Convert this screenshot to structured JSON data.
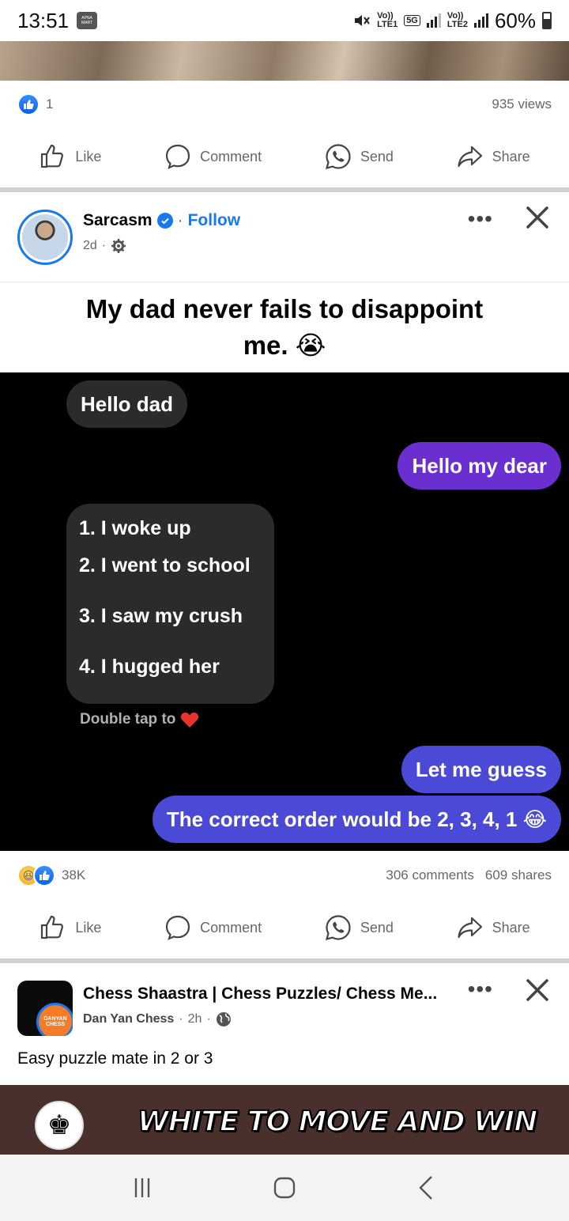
{
  "status_bar": {
    "time": "13:51",
    "carrier_badge": "APNA MART",
    "sim1_label": "Vo))",
    "sim1_sub": "LTE1",
    "network": "5G",
    "sim2_label": "Vo))",
    "sim2_sub": "LTE2",
    "battery": "60%"
  },
  "previous_post": {
    "like_count": "1",
    "views": "935 views"
  },
  "actions": {
    "like": "Like",
    "comment": "Comment",
    "send": "Send",
    "share": "Share"
  },
  "post": {
    "author": "Sarcasm",
    "separator": "·",
    "follow": "Follow",
    "time": "2d",
    "caption": "My dad never fails to disappoint me. 😭",
    "chat": {
      "msg1": "Hello dad",
      "msg2": "Hello my dear",
      "list": [
        "1. I woke up",
        "2. I went to school",
        "3. I saw my crush",
        "4. I hugged her"
      ],
      "double_tap": "Double tap to",
      "msg3": "Let me guess",
      "msg4": "The correct order would be 2, 3, 4, 1 😂"
    },
    "reactions": "38K",
    "comments": "306 comments",
    "shares": "609 shares"
  },
  "chess_post": {
    "title": "Chess Shaastra | Chess Puzzles/ Chess Me...",
    "page_name": "Dan Yan Chess",
    "time": "2h",
    "avatar_text": "DANYAN CHESS",
    "caption": "Easy puzzle mate in 2 or 3",
    "banner": "WHITE TO MOVE AND WIN"
  },
  "colors": {
    "accent": "#1877f2",
    "purple_bubble": "#6b2fd1",
    "blue_bubble": "#4a4ad6",
    "banner_bg": "#4a302c"
  }
}
